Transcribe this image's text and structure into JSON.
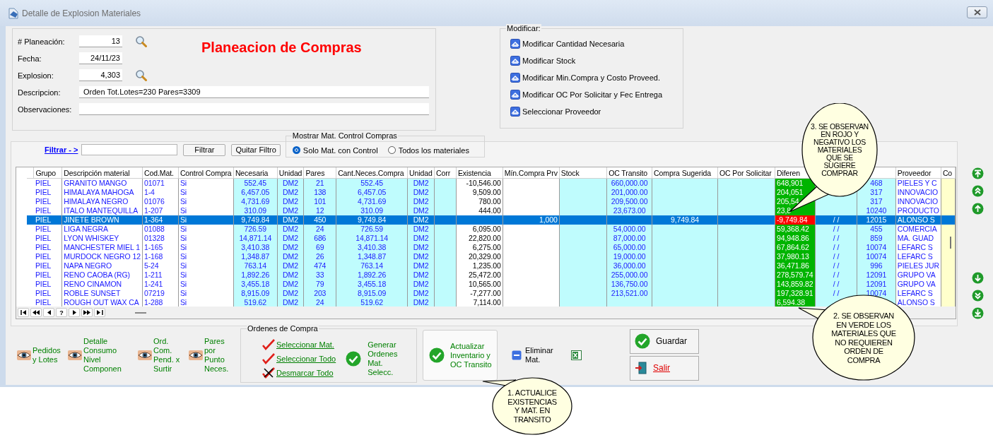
{
  "window": {
    "title": "Detalle de Explosion Materiales"
  },
  "header": {
    "heading": "Planeacion de Compras",
    "fields": [
      {
        "label": "# Planeación:",
        "value": "13",
        "kind": "short",
        "lookup": true
      },
      {
        "label": "Fecha:",
        "value": "24/11/23",
        "kind": "short",
        "lookup": false
      },
      {
        "label": "Explosion:",
        "value": "4,303",
        "kind": "short",
        "lookup": true
      },
      {
        "label": "Descripcion:",
        "value": "Orden  Tot.Lotes=230 Pares=3309",
        "kind": "wide"
      },
      {
        "label": "Observaciones:",
        "kind": "wide"
      }
    ]
  },
  "modificar": {
    "legend": "Modificar:",
    "actions": [
      "Modificar Cantidad Necesaria",
      "Modificar Stock",
      "Modificar Min.Compra y Costo Proveed.",
      "Modificar OC Por Solicitar y Fec Entrega",
      "Seleccionar Proveedor"
    ]
  },
  "filter": {
    "label": "Filtrar - >",
    "buttons": [
      "Filtrar",
      "Quitar Filtro"
    ],
    "mostrar": {
      "legend": "Mostrar Mat. Control Compras",
      "options": [
        {
          "label": "Solo Mat. con Control",
          "selected": true
        },
        {
          "label": "Todos los materiales",
          "selected": false
        }
      ]
    }
  },
  "table": {
    "columns": [
      {
        "label": "Grupo"
      },
      {
        "label": "Descripción material"
      },
      {
        "label": "Cod.Mat."
      },
      {
        "label": "Control Compra"
      },
      {
        "label": "Necesaria"
      },
      {
        "label": "Unidad"
      },
      {
        "label": "Pares"
      },
      {
        "label": "Cant.Neces.Compra"
      },
      {
        "label": "Unidad"
      },
      {
        "label": "Corr"
      },
      {
        "label": "Existencia"
      },
      {
        "label": "Mín.Compra Prv"
      },
      {
        "label": "Stock"
      },
      {
        "label": "OC Transito"
      },
      {
        "label": "Compra Sugerida"
      },
      {
        "label": "OC Por Solicitar"
      },
      {
        "label": "Diferen"
      },
      {},
      {},
      {
        "label": "Proveedor"
      },
      {
        "label": "Co"
      }
    ],
    "rows": [
      {
        "selected": false,
        "color": "#00b400",
        "cells": [
          "PIEL",
          "GRANITO MANGO",
          "01071",
          "Si",
          "552.45",
          "DM2",
          "21",
          "552.45",
          "DM2",
          null,
          "-10,546.00",
          null,
          null,
          "660,000.00",
          null,
          null,
          "648,901",
          null,
          "468",
          "PIELES Y C",
          null
        ]
      },
      {
        "selected": false,
        "color": "#00b400",
        "cells": [
          "PIEL",
          "HIMALAYA MAHOGA",
          "1-4",
          "Si",
          "6,457.05",
          "DM2",
          "138",
          "6,457.05",
          "DM2",
          null,
          "9,509.00",
          null,
          null,
          "201,000.00",
          null,
          null,
          "204,051",
          null,
          "317",
          "INNOVACIO",
          null
        ]
      },
      {
        "selected": false,
        "color": "#00b400",
        "cells": [
          "PIEL",
          "HIMALAYA NEGRO",
          "01076",
          "Si",
          "4,731.69",
          "DM2",
          "101",
          "4,731.69",
          "DM2",
          null,
          "780.00",
          null,
          null,
          "209,500.00",
          null,
          null,
          "205,54",
          null,
          "317",
          "INNOVACIO",
          null
        ]
      },
      {
        "selected": false,
        "color": "#00b400",
        "cells": [
          "PIEL",
          "ITALO MANTEQUILLA",
          "1-207",
          "Si",
          "310.09",
          "DM2",
          "12",
          "310.09",
          "DM2",
          null,
          "444.00",
          null,
          null,
          "23,673.00",
          null,
          null,
          "23,8",
          null,
          "10240",
          "PRODUCTO",
          null
        ]
      },
      {
        "selected": true,
        "color": "#ff0000",
        "cells": [
          "PIEL",
          "JINETE BROWN",
          "1-364",
          "Si",
          "9,749.84",
          "DM2",
          "450",
          "9,749.84",
          "DM2",
          null,
          null,
          "1,000",
          null,
          null,
          "9,749.84",
          null,
          "-9,749.84",
          "/ /",
          "12015",
          "ALONSO S",
          null
        ]
      },
      {
        "selected": false,
        "color": "#00b400",
        "cells": [
          "PIEL",
          "LIGA NEGRA",
          "01088",
          "Si",
          "726.59",
          "DM2",
          "24",
          "726.59",
          "DM2",
          null,
          "6,095.00",
          null,
          null,
          "54,000.00",
          null,
          null,
          "59,368.42",
          "/ /",
          "455",
          "COMERCIA",
          null
        ]
      },
      {
        "selected": false,
        "color": "#00b400",
        "cells": [
          "PIEL",
          "LYON WHISKEY",
          "01328",
          "Si",
          "14,871.14",
          "DM2",
          "686",
          "14,871.14",
          "DM2",
          null,
          "22,820.00",
          null,
          null,
          "87,000.00",
          null,
          null,
          "94,948.86",
          "/ /",
          "859",
          "MA. GUAD",
          null
        ]
      },
      {
        "selected": false,
        "color": "#00b400",
        "cells": [
          "PIEL",
          "MANCHESTER MIEL 1",
          "1-165",
          "Si",
          "3,410.38",
          "DM2",
          "69",
          "3,410.38",
          "DM2",
          null,
          "6,275.00",
          null,
          null,
          "65,000.00",
          null,
          null,
          "67,864.62",
          "/ /",
          "10074",
          "LEFARC S",
          null
        ]
      },
      {
        "selected": false,
        "color": "#00b400",
        "cells": [
          "PIEL",
          "MURDOCK NEGRO 12",
          "1-168",
          "Si",
          "1,348.87",
          "DM2",
          "26",
          "1,348.87",
          "DM2",
          null,
          "20,329.00",
          null,
          null,
          "19,000.00",
          null,
          null,
          "37,980.13",
          "/ /",
          "10074",
          "LEFARC S",
          null
        ]
      },
      {
        "selected": false,
        "color": "#00b400",
        "cells": [
          "PIEL",
          "NAPA NEGRO",
          "5-24",
          "Si",
          "763.14",
          "DM2",
          "474",
          "763.14",
          "DM2",
          null,
          "1,235.00",
          null,
          null,
          "36,000.00",
          null,
          null,
          "36,471.86",
          "/ /",
          "996",
          "PIELES JUR",
          null
        ]
      },
      {
        "selected": false,
        "color": "#00b400",
        "cells": [
          "PIEL",
          "RENO CAOBA (RG)",
          "1-211",
          "Si",
          "1,892.26",
          "DM2",
          "33",
          "1,892.26",
          "DM2",
          null,
          "25,472.00",
          null,
          null,
          "255,000.00",
          null,
          null,
          "278,579.74",
          "/ /",
          "12091",
          "GRUPO VA",
          null
        ]
      },
      {
        "selected": false,
        "color": "#00b400",
        "cells": [
          "PIEL",
          "RENO CINAMON",
          "1-241",
          "Si",
          "3,455.18",
          "DM2",
          "79",
          "3,455.18",
          "DM2",
          null,
          "10,565.00",
          null,
          null,
          "136,750.00",
          null,
          null,
          "143,859.82",
          "/ /",
          "12091",
          "GRUPO VA",
          null
        ]
      },
      {
        "selected": false,
        "color": "#00b400",
        "cells": [
          "PIEL",
          "ROBLE SUNSET",
          "07219",
          "Si",
          "8,915.09",
          "DM2",
          "203",
          "8,915.09",
          "DM2",
          null,
          "-7,277.00",
          null,
          null,
          "213,521.00",
          null,
          null,
          "197,328.91",
          "/ /",
          "10074",
          "LEFARC S",
          null
        ]
      },
      {
        "selected": false,
        "color": "#00b400",
        "cells": [
          "PIEL",
          "ROUGH OUT WAX CA",
          "1-288",
          "Si",
          "519.62",
          "DM2",
          "24",
          "519.62",
          "DM2",
          null,
          "7,114.00",
          null,
          null,
          null,
          null,
          null,
          "6,594.38",
          null,
          null,
          "ALONSO S",
          null
        ]
      }
    ],
    "navigator": {
      "find": "?"
    }
  },
  "toolbar": {
    "links": [
      "Pedidos\ny Lotes",
      "Detalle\nConsumo\nNivel\nComponen",
      "Ord.\nCom.\nPend. x\nSurtir",
      "Pares\npor\nPunto\nNeces."
    ],
    "ordenes": {
      "legend": "Ordenes de Compra",
      "items": [
        {
          "label": "Seleccionar Mat.",
          "kind": "check"
        },
        {
          "label": "Seleccionar Todo",
          "kind": "check"
        },
        {
          "label": "Desmarcar Todo",
          "kind": "uncheck"
        }
      ],
      "generate": "Generar\nOrdenes\nMat.\nSelecc."
    },
    "actualizar": "Actualizar\nInventario y\nOC Transito",
    "eliminar": "Eliminar\nMat.",
    "buttons": [
      {
        "label": "Guardar",
        "kind": "save"
      },
      {
        "label": "Salir",
        "kind": "exit"
      }
    ]
  },
  "callouts": [
    {
      "text": "3. SE OBSERVAN\nEN ROJO Y\nNEGATIVO LOS\nMATERIALES\nQUE SE\nSUGIERE\nCOMPRAR"
    },
    {
      "text": "2. SE OBSERVAN\nEN VERDE LOS\nMATERIALES QUE\nNO REQUIEREN\nORDEN DE\nCOMPRA"
    },
    {
      "text": "1. ACTUALICE\nEXISTENCIAS\nY MAT. EN\nTRANSITO"
    }
  ]
}
